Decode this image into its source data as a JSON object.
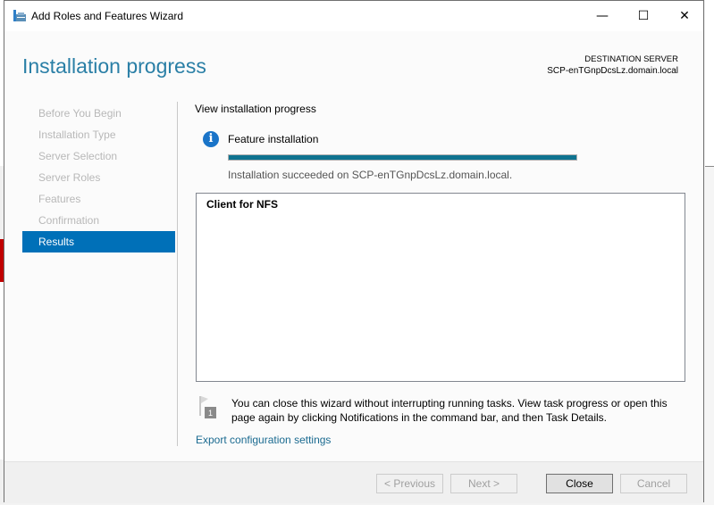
{
  "window": {
    "title": "Add Roles and Features Wizard",
    "controls": {
      "minimize": "—",
      "maximize": "☐",
      "close": "✕"
    }
  },
  "header": {
    "title": "Installation progress",
    "destination_label": "DESTINATION SERVER",
    "destination_server": "SCP-enTGnpDcsLz.domain.local"
  },
  "nav": {
    "items": [
      {
        "label": "Before You Begin",
        "state": "disabled"
      },
      {
        "label": "Installation Type",
        "state": "disabled"
      },
      {
        "label": "Server Selection",
        "state": "disabled"
      },
      {
        "label": "Server Roles",
        "state": "disabled"
      },
      {
        "label": "Features",
        "state": "disabled"
      },
      {
        "label": "Confirmation",
        "state": "disabled"
      },
      {
        "label": "Results",
        "state": "active"
      }
    ]
  },
  "main": {
    "view_label": "View installation progress",
    "info_icon_glyph": "i",
    "feature_label": "Feature installation",
    "progress_percent": 100,
    "status_text": "Installation succeeded on SCP-enTGnpDcsLz.domain.local.",
    "results": [
      "Client for NFS"
    ],
    "note_badge": "1",
    "note": "You can close this wizard without interrupting running tasks. View task progress or open this page again by clicking Notifications in the command bar, and then Task Details.",
    "export_link": "Export configuration settings"
  },
  "footer": {
    "previous": "< Previous",
    "next": "Next >",
    "close": "Close",
    "cancel": "Cancel"
  },
  "colors": {
    "accent": "#0070b8",
    "header_title": "#2a7fa6",
    "progress_fill": "#0f7390",
    "link": "#1a6a90"
  }
}
